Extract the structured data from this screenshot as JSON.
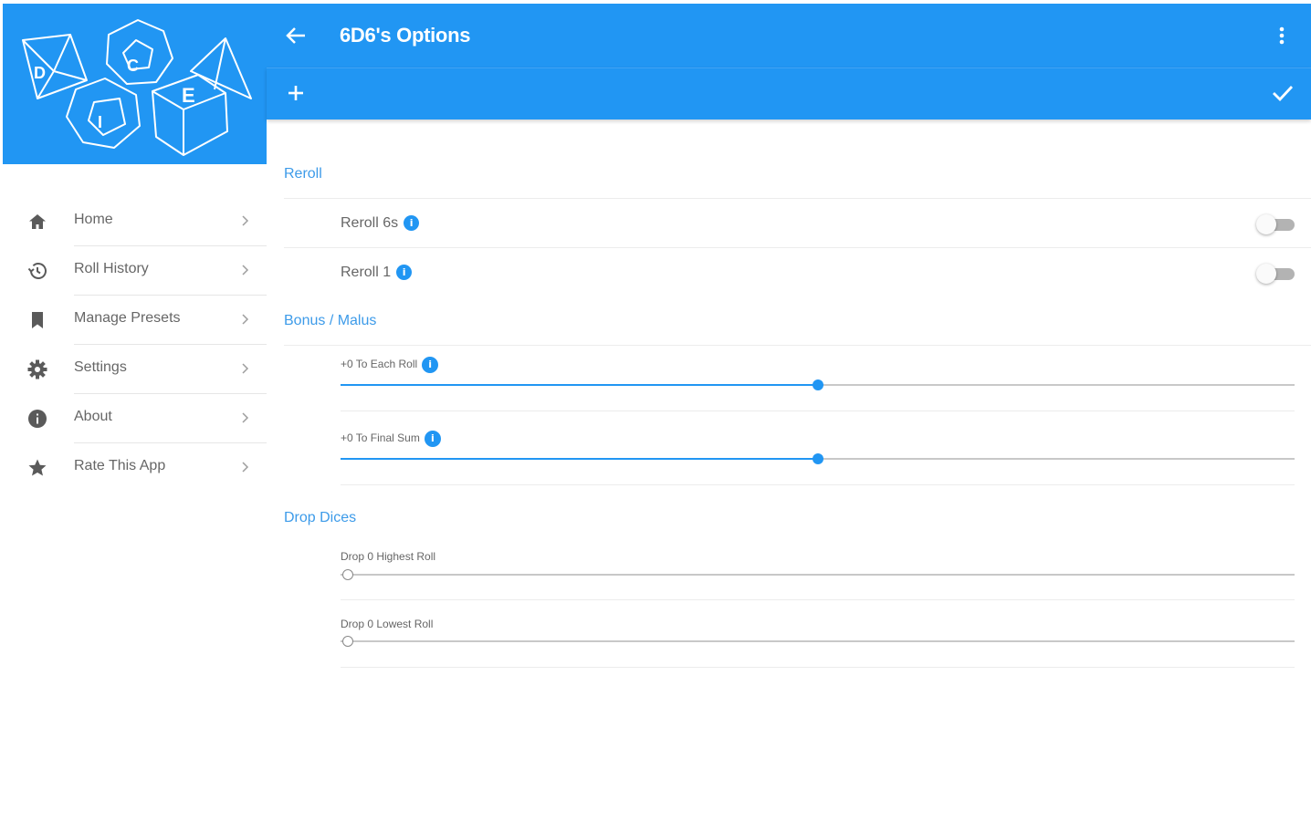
{
  "colors": {
    "primary": "#2196f3",
    "section_title": "#3d9be9",
    "text": "#666666"
  },
  "appbar": {
    "title": "6D6's Options",
    "back_icon": "arrow-left-icon",
    "more_icon": "more-vert-icon"
  },
  "subbar": {
    "add_icon": "plus-icon",
    "confirm_icon": "check-icon"
  },
  "sidebar": {
    "logo_name": "DICE",
    "items": [
      {
        "label": "Home",
        "icon": "home-icon"
      },
      {
        "label": "Roll History",
        "icon": "history-icon"
      },
      {
        "label": "Manage Presets",
        "icon": "bookmark-icon"
      },
      {
        "label": "Settings",
        "icon": "gear-icon"
      },
      {
        "label": "About",
        "icon": "info-icon"
      },
      {
        "label": "Rate This App",
        "icon": "star-icon"
      }
    ]
  },
  "sections": {
    "reroll": {
      "title": "Reroll",
      "options": [
        {
          "label": "Reroll 6s",
          "info": "i",
          "enabled": false
        },
        {
          "label": "Reroll 1",
          "info": "i",
          "enabled": false
        }
      ]
    },
    "bonus": {
      "title": "Bonus / Malus",
      "sliders": [
        {
          "label": "+0 To Each Roll",
          "info": "i",
          "value": 0,
          "fraction": 0.5
        },
        {
          "label": "+0 To Final Sum",
          "info": "i",
          "value": 0,
          "fraction": 0.5
        }
      ]
    },
    "drop": {
      "title": "Drop Dices",
      "sliders": [
        {
          "label": "Drop 0 Highest Roll",
          "value": 0,
          "fraction": 0.0
        },
        {
          "label": "Drop 0 Lowest Roll",
          "value": 0,
          "fraction": 0.0
        }
      ]
    }
  }
}
